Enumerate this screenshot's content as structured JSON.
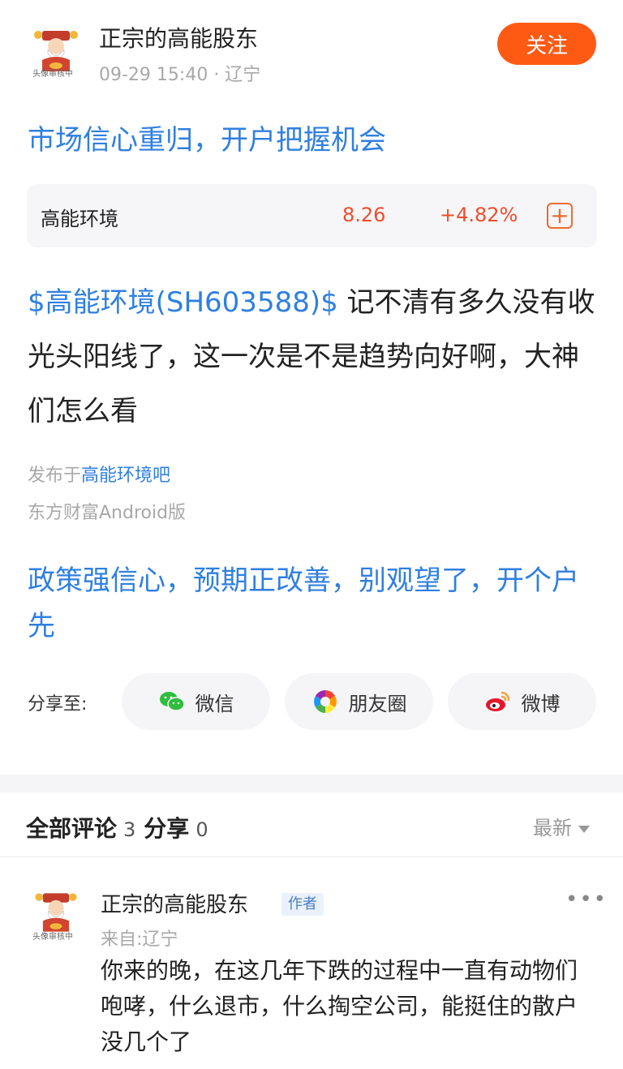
{
  "post": {
    "author": "正宗的高能股东",
    "meta": "09-29 15:40 · 辽宁",
    "follow_label": "关注",
    "avatar_caption": "头像审核中",
    "title": "市场信心重归，开户把握机会",
    "stock_card": {
      "name": "高能环境",
      "price": "8.26",
      "change": "+4.82%",
      "add_symbol": "+"
    },
    "body_tag": "$高能环境(SH603588)$",
    "body_text": " 记不清有多久没有收光头阳线了，这一次是不是趋势向好啊，大神们怎么看",
    "posted_prefix": "发布于",
    "posted_board": "高能环境吧",
    "client": "东方财富Android版",
    "promo": "政策强信心，预期正改善，别观望了，开个户先"
  },
  "share": {
    "label": "分享至:",
    "targets": [
      {
        "label": "微信",
        "icon": "wechat-icon"
      },
      {
        "label": "朋友圈",
        "icon": "moments-icon"
      },
      {
        "label": "微博",
        "icon": "weibo-icon"
      }
    ]
  },
  "comments": {
    "all_label": "全部评论",
    "all_count": "3",
    "share_label": "分享",
    "share_count": "0",
    "sort_label": "最新",
    "items": [
      {
        "author": "正宗的高能股东",
        "badge": "作者",
        "more": "•••",
        "from": "来自:辽宁",
        "avatar_caption": "头像审核中",
        "text": "你来的晚，在这几年下跌的过程中一直有动物们咆哮，什么退市，什么掏空公司，能挺住的散户没几个了"
      }
    ]
  },
  "colors": {
    "link_blue": "#2f7fe0",
    "accent_orange": "#ff5a14",
    "stock_red": "#ee4c2c"
  }
}
